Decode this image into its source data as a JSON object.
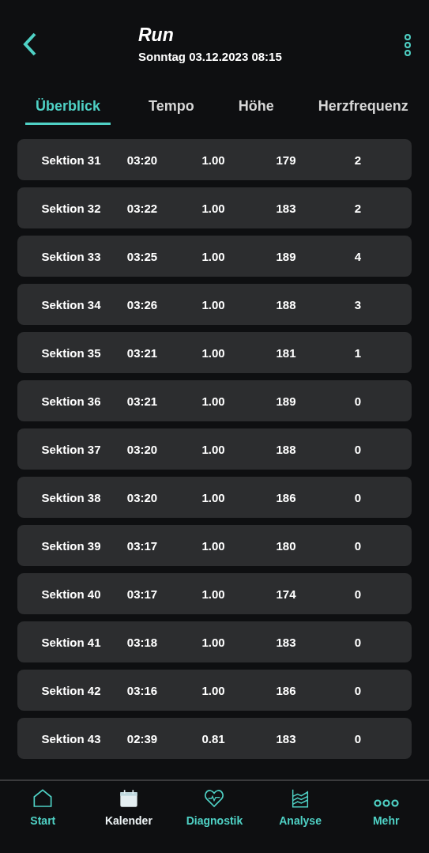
{
  "header": {
    "title": "Run",
    "subtitle": "Sonntag 03.12.2023 08:15"
  },
  "tabs": [
    {
      "label": "Überblick",
      "selected": true
    },
    {
      "label": "Tempo",
      "selected": false
    },
    {
      "label": "Höhe",
      "selected": false
    },
    {
      "label": "Herzfrequenz",
      "selected": false
    }
  ],
  "rows": [
    [
      "Sektion 31",
      "03:20",
      "1.00",
      "179",
      "2"
    ],
    [
      "Sektion 32",
      "03:22",
      "1.00",
      "183",
      "2"
    ],
    [
      "Sektion 33",
      "03:25",
      "1.00",
      "189",
      "4"
    ],
    [
      "Sektion 34",
      "03:26",
      "1.00",
      "188",
      "3"
    ],
    [
      "Sektion 35",
      "03:21",
      "1.00",
      "181",
      "1"
    ],
    [
      "Sektion 36",
      "03:21",
      "1.00",
      "189",
      "0"
    ],
    [
      "Sektion 37",
      "03:20",
      "1.00",
      "188",
      "0"
    ],
    [
      "Sektion 38",
      "03:20",
      "1.00",
      "186",
      "0"
    ],
    [
      "Sektion 39",
      "03:17",
      "1.00",
      "180",
      "0"
    ],
    [
      "Sektion 40",
      "03:17",
      "1.00",
      "174",
      "0"
    ],
    [
      "Sektion 41",
      "03:18",
      "1.00",
      "183",
      "0"
    ],
    [
      "Sektion 42",
      "03:16",
      "1.00",
      "186",
      "0"
    ],
    [
      "Sektion 43",
      "02:39",
      "0.81",
      "183",
      "0"
    ]
  ],
  "nav": [
    {
      "kind": "home",
      "label": "Start",
      "selected": false
    },
    {
      "kind": "calendar",
      "label": "Kalender",
      "selected": true
    },
    {
      "kind": "heart",
      "label": "Diagnostik",
      "selected": false
    },
    {
      "kind": "chart",
      "label": "Analyse",
      "selected": false
    },
    {
      "kind": "more",
      "label": "Mehr",
      "selected": false
    }
  ]
}
